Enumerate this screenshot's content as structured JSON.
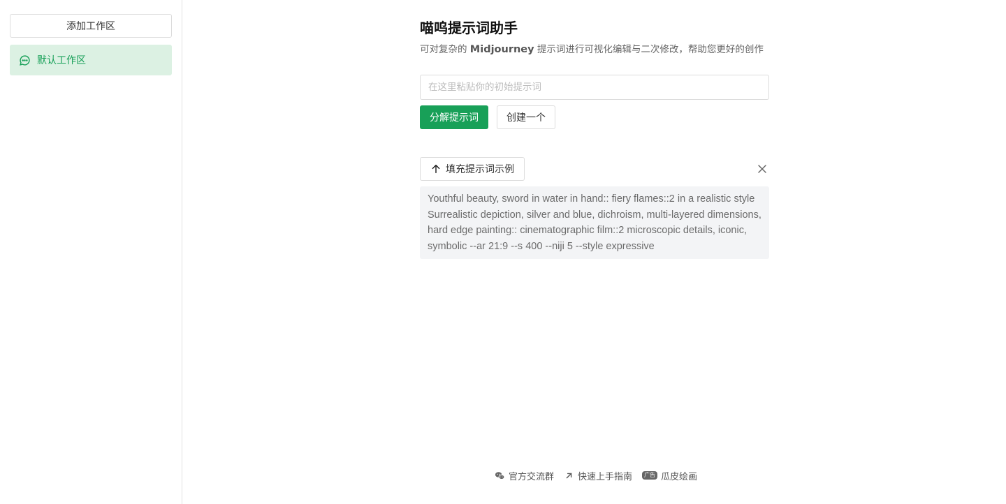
{
  "sidebar": {
    "add_workspace_label": "添加工作区",
    "items": [
      {
        "label": "默认工作区",
        "icon": "chat-bubble-icon",
        "active": true
      }
    ]
  },
  "header": {
    "title": "喵呜提示词助手",
    "subtitle_before": "可对复杂的 ",
    "subtitle_brand": "Midjourney",
    "subtitle_after": " 提示词进行可视化编辑与二次修改，帮助您更好的创作"
  },
  "input": {
    "placeholder": "在这里粘贴你的初始提示词",
    "value": ""
  },
  "actions": {
    "decompose_label": "分解提示词",
    "create_label": "创建一个"
  },
  "example": {
    "fill_label": "填充提示词示例",
    "text": "Youthful beauty, sword in water in hand:: fiery flames::2 in a realistic style Surrealistic depiction, silver and blue, dichroism, multi-layered dimensions, hard edge painting:: cinematographic film::2 microscopic details, iconic, symbolic --ar 21:9 --s 400 --niji 5 --style expressive"
  },
  "footer": {
    "links": [
      {
        "label": "官方交流群",
        "icon": "wechat-icon"
      },
      {
        "label": "快速上手指南",
        "icon": "arrow-up-right-icon"
      },
      {
        "label": "瓜皮绘画",
        "icon": "ad-badge-icon",
        "badge": "广告"
      }
    ]
  },
  "colors": {
    "accent": "#18a058",
    "active_bg": "#dcf1e3"
  }
}
